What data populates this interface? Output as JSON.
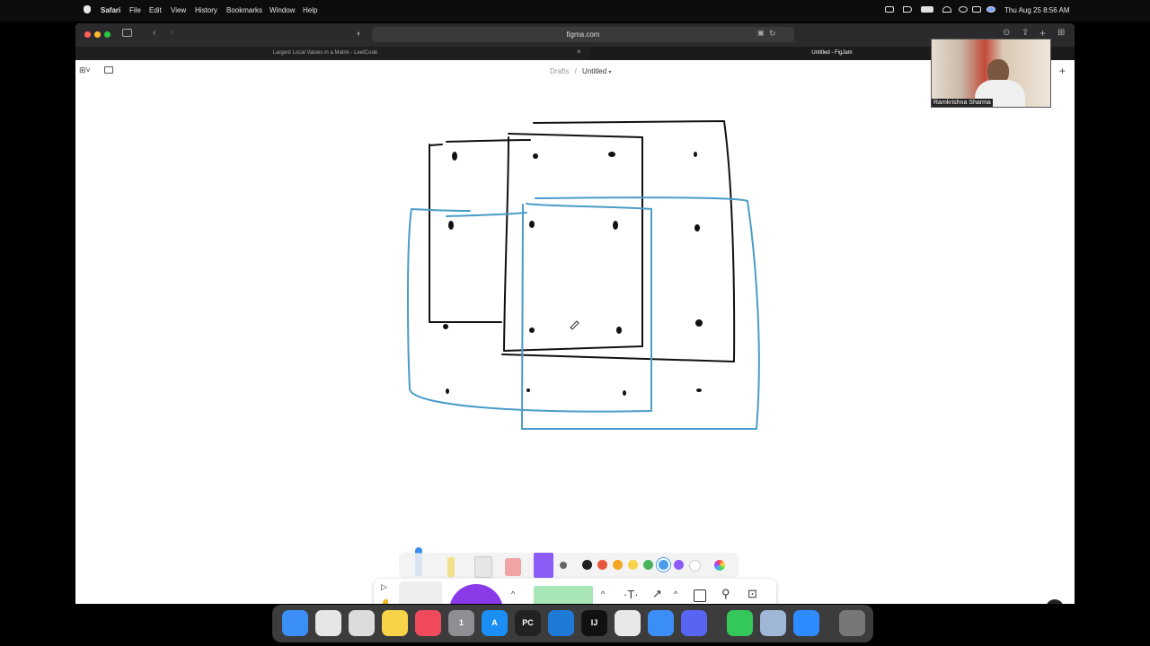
{
  "menubar": {
    "app": "Safari",
    "items": [
      "File",
      "Edit",
      "View",
      "History",
      "Bookmarks",
      "Window",
      "Help"
    ],
    "clock": "Thu Aug 25  8:56 AM"
  },
  "browser": {
    "url": "figma.com",
    "tabs": [
      {
        "label": "Largest Local Values in a Matrix - LeetCode"
      },
      {
        "label": "Untitled - FigJam"
      }
    ]
  },
  "figjam": {
    "breadcrumb_parent": "Drafts",
    "breadcrumb_sep": "/",
    "file_name": "Untitled",
    "help": "?"
  },
  "webcam": {
    "name": "Ramkrishna Sharma"
  },
  "palette": {
    "colors": [
      "#1e1e1e",
      "#e8553a",
      "#f5a623",
      "#f7d348",
      "#4bb35d",
      "#4a9de8",
      "#8b5cf6",
      "#ffffff"
    ],
    "selected": "#4a9de8"
  },
  "dock": {
    "apps": [
      {
        "name": "finder-icon",
        "color": "#3b8ef5",
        "text": ""
      },
      {
        "name": "launchpad-icon",
        "color": "#e6e6e6",
        "text": ""
      },
      {
        "name": "screenshot-icon",
        "color": "#dcdcdc",
        "text": ""
      },
      {
        "name": "notes-icon",
        "color": "#f7d348",
        "text": ""
      },
      {
        "name": "news-icon",
        "color": "#f04a5c",
        "text": ""
      },
      {
        "name": "system-preferences-icon",
        "color": "#8e8e93",
        "text": "1"
      },
      {
        "name": "app-store-icon",
        "color": "#1b8ff5",
        "text": "A"
      },
      {
        "name": "pycharm-icon",
        "color": "#222",
        "text": "PC"
      },
      {
        "name": "vscode-icon",
        "color": "#1e7ad6",
        "text": ""
      },
      {
        "name": "intellij-icon",
        "color": "#111",
        "text": "IJ"
      },
      {
        "name": "chrome-icon",
        "color": "#e8e8e8",
        "text": ""
      },
      {
        "name": "safari-icon",
        "color": "#3b8ef5",
        "text": ""
      },
      {
        "name": "discord-icon",
        "color": "#5865f2",
        "text": ""
      },
      {
        "name": "messages-icon",
        "color": "#34c759",
        "text": ""
      },
      {
        "name": "preview-icon",
        "color": "#9fb6d6",
        "text": ""
      },
      {
        "name": "zoom-icon",
        "color": "#2d8cff",
        "text": ""
      },
      {
        "name": "trash-icon",
        "color": "#777",
        "text": ""
      }
    ]
  }
}
